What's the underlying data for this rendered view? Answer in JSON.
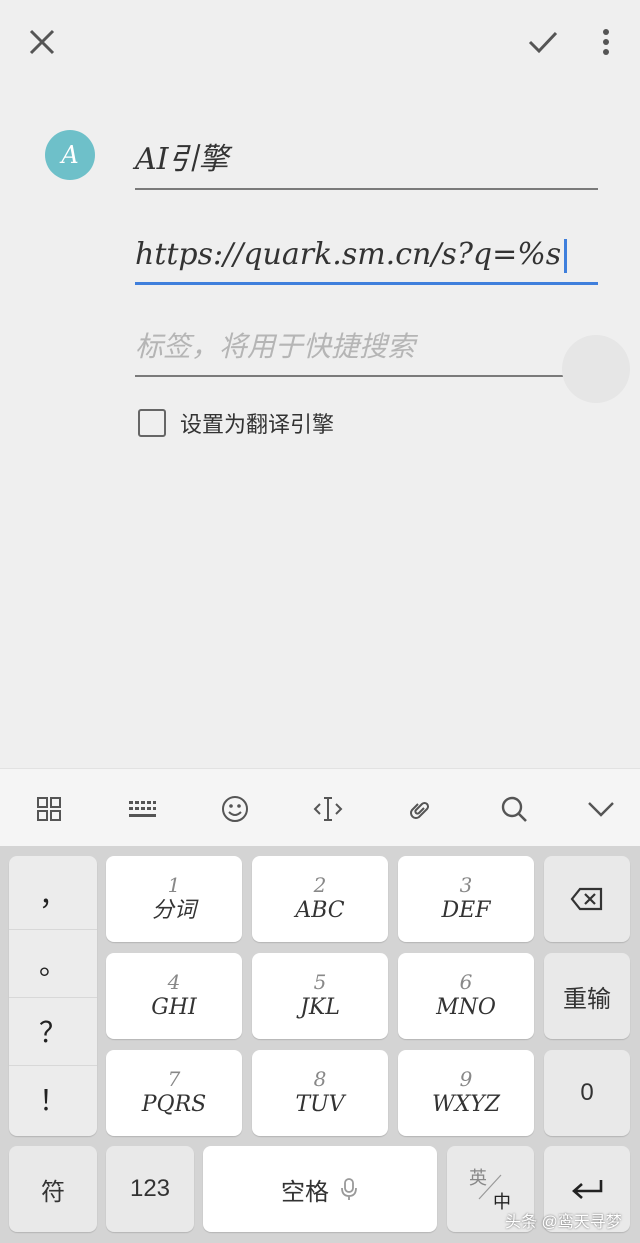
{
  "topbar": {
    "close_icon": "close-icon",
    "confirm_icon": "check-icon",
    "more_icon": "more-vertical-icon"
  },
  "form": {
    "avatar_letter": "A",
    "name_value": "AI引擎",
    "url_value": "https://quark.sm.cn/s?q=%s",
    "tags_placeholder": "标签，将用于快捷搜索",
    "translate_checkbox_label": "设置为翻译引擎",
    "translate_checked": false
  },
  "keyboard_toolbar": {
    "icons": [
      "grid-icon",
      "keyboard-icon",
      "emoji-icon",
      "cursor-icon",
      "clipboard-icon",
      "search-icon",
      "chevron-down-icon"
    ]
  },
  "keyboard": {
    "punctuation": [
      "，",
      "。",
      "？",
      "！"
    ],
    "keys": [
      {
        "num": "1",
        "letters": "分词"
      },
      {
        "num": "2",
        "letters": "ABC"
      },
      {
        "num": "3",
        "letters": "DEF"
      },
      {
        "num": "4",
        "letters": "GHI"
      },
      {
        "num": "5",
        "letters": "JKL"
      },
      {
        "num": "6",
        "letters": "MNO"
      },
      {
        "num": "7",
        "letters": "PQRS"
      },
      {
        "num": "8",
        "letters": "TUV"
      },
      {
        "num": "9",
        "letters": "WXYZ"
      }
    ],
    "reinput": "重输",
    "zero": "0",
    "symbol": "符",
    "numbers": "123",
    "space": "空格",
    "lang_top": "英",
    "lang_bottom": "中"
  },
  "watermark": "头条 @鸾天寻梦"
}
